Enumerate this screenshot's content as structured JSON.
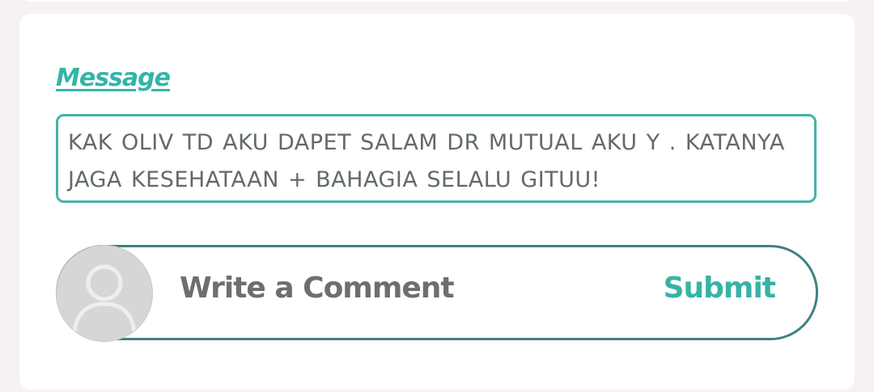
{
  "form": {
    "message_label": "Message",
    "message_text": "KAK OLIV TD AKU DAPET SALAM DR MUTUAL AKU Y . KATANYA JAGA KESEHATAAN + BAHAGIA SELALU GITUU!"
  },
  "comment": {
    "placeholder": "Write a Comment",
    "submit_label": "Submit",
    "avatar_icon": "user-silhouette-icon"
  },
  "colors": {
    "accent": "#36b3a5",
    "bar_border": "#3f827f",
    "text": "#626a6a"
  }
}
